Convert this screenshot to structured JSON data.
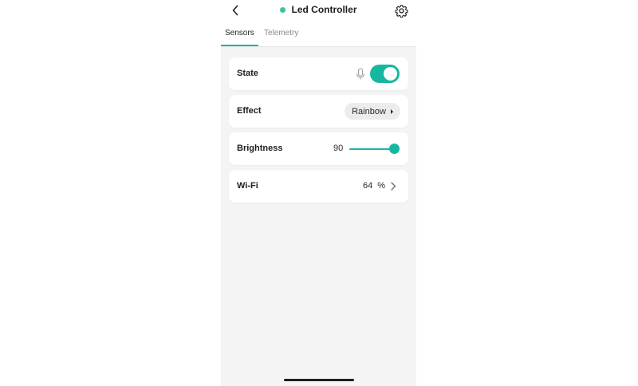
{
  "header": {
    "title": "Led Controller",
    "status_color": "#3cc29a",
    "back_icon": "chevron-left-icon",
    "settings_icon": "gear-icon"
  },
  "tabs": [
    {
      "label": "Sensors",
      "active": true
    },
    {
      "label": "Telemetry",
      "active": false
    }
  ],
  "accent_color": "#16b7a0",
  "cards": {
    "state": {
      "label": "State",
      "toggle_on": true,
      "mic_icon": "microphone-icon"
    },
    "effect": {
      "label": "Effect",
      "value": "Rainbow"
    },
    "brightness": {
      "label": "Brightness",
      "value": "90",
      "level_percent": 90
    },
    "wifi": {
      "label": "Wi-Fi",
      "value": "64 %"
    }
  }
}
